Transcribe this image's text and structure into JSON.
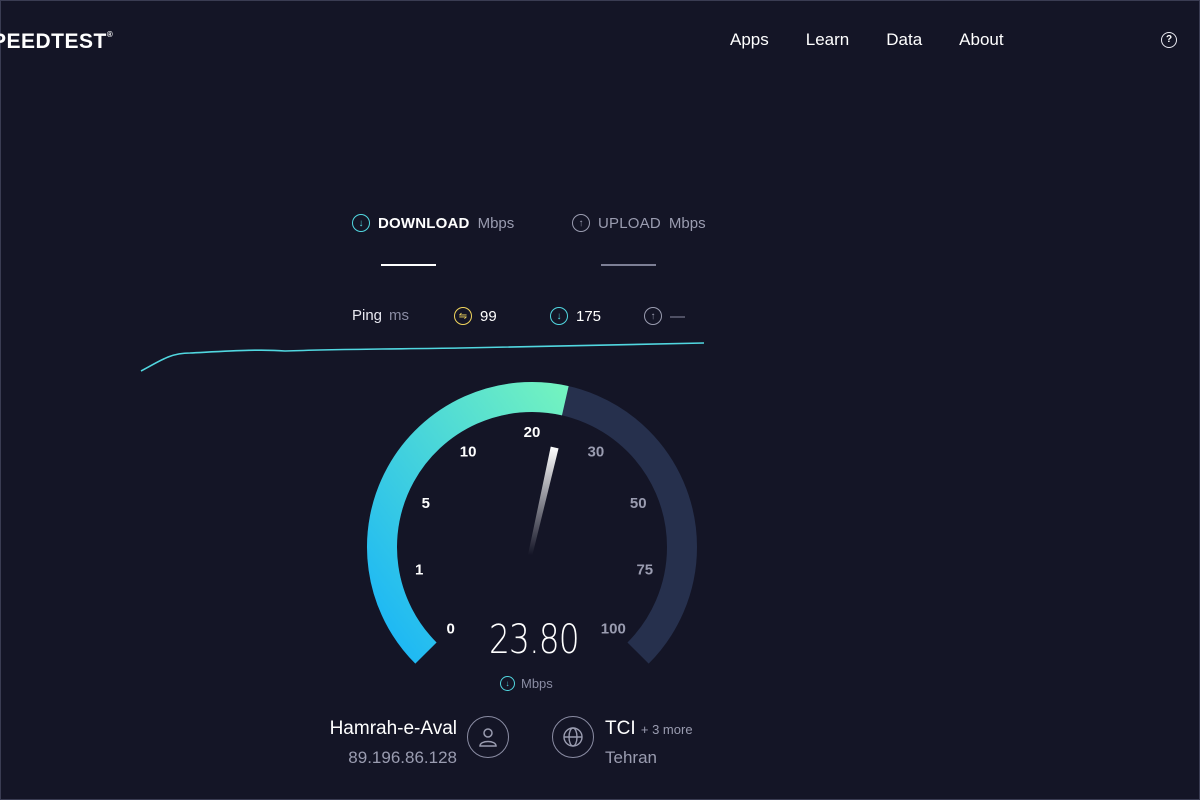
{
  "header": {
    "logo": "PEEDTEST",
    "logo_mark": "®",
    "nav": [
      "Apps",
      "Learn",
      "Data",
      "About"
    ],
    "help_icon": "?"
  },
  "tabs": {
    "download": {
      "label": "DOWNLOAD",
      "unit": "Mbps",
      "icon": "arrow-down-icon"
    },
    "upload": {
      "label": "UPLOAD",
      "unit": "Mbps",
      "icon": "arrow-up-icon"
    }
  },
  "ping": {
    "label": "Ping",
    "unit": "ms",
    "idle": "99",
    "download": "175",
    "upload": "—"
  },
  "gauge": {
    "ticks": [
      "0",
      "1",
      "5",
      "10",
      "20",
      "30",
      "50",
      "75",
      "100"
    ],
    "value": "23.80",
    "value_unit": "Mbps",
    "colors": {
      "fill_start": "#19b5f7",
      "fill_end": "#72f2c0",
      "track": "#26304d",
      "needle": "#ffffff"
    }
  },
  "client": {
    "provider": "Hamrah-e-Aval",
    "ip": "89.196.86.128"
  },
  "server": {
    "name": "TCI",
    "more": "+ 3 more",
    "location": "Tehran"
  },
  "colors": {
    "background": "#141526",
    "accent": "#51d7e0",
    "ping_idle": "#f1d55d"
  }
}
